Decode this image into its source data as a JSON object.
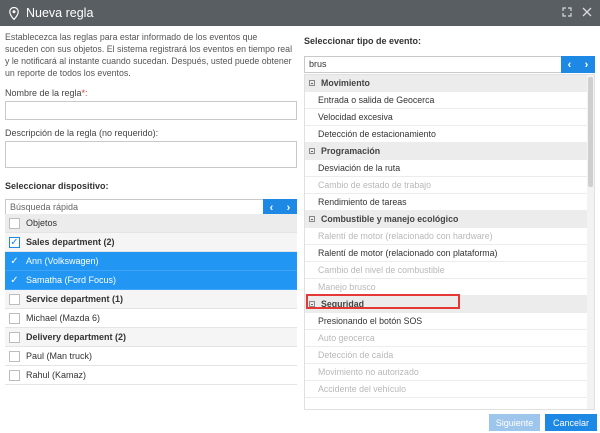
{
  "window": {
    "title": "Nueva regla",
    "icon": "map-pin-icon",
    "controls": [
      "expand-icon",
      "close-icon"
    ]
  },
  "intro": "Establecezca las reglas para estar informado de los eventos que suceden con sus objetos. El sistema registrará los eventos en tiempo real y le notificará al instante cuando sucedan. Después, usted puede obtener un reporte de todos los eventos.",
  "rule_name": {
    "label": "Nombre de la regla",
    "required_mark": "*:",
    "value": ""
  },
  "rule_desc": {
    "label": "Descripción de la regla (no requerido):",
    "value": ""
  },
  "device": {
    "label": "Seleccionar dispositivo:",
    "search_placeholder": "Búsqueda rápida",
    "header": "Objetos",
    "rows": [
      {
        "label": "Sales department (2)",
        "type": "group",
        "checked": true
      },
      {
        "label": "Ann (Volkswagen)",
        "type": "item",
        "checked": true
      },
      {
        "label": "Samatha (Ford Focus)",
        "type": "item",
        "checked": true
      },
      {
        "label": "Service department (1)",
        "type": "group",
        "checked": false
      },
      {
        "label": "Michael (Mazda 6)",
        "type": "item",
        "checked": false
      },
      {
        "label": "Delivery department (2)",
        "type": "group",
        "checked": false
      },
      {
        "label": "Paul (Man truck)",
        "type": "item",
        "checked": false
      },
      {
        "label": "Rahul (Kamaz)",
        "type": "item",
        "checked": false
      }
    ]
  },
  "event": {
    "label": "Seleccionar tipo de evento:",
    "search_value": "brus",
    "categories": [
      {
        "name": "Movimiento",
        "items": [
          {
            "label": "Entrada o salida de Geocerca",
            "enabled": true
          },
          {
            "label": "Velocidad excesiva",
            "enabled": true
          },
          {
            "label": "Detección de estacionamiento",
            "enabled": true
          }
        ]
      },
      {
        "name": "Programación",
        "items": [
          {
            "label": "Desviación de la ruta",
            "enabled": true
          },
          {
            "label": "Cambio de estado de trabajo",
            "enabled": false
          },
          {
            "label": "Rendimiento de tareas",
            "enabled": true
          }
        ]
      },
      {
        "name": "Combustible y manejo ecológico",
        "items": [
          {
            "label": "Ralentí de motor (relacionado con hardware)",
            "enabled": false
          },
          {
            "label": "Ralentí de motor (relacionado con plataforma)",
            "enabled": true
          },
          {
            "label": "Cambio del nivel de combustible",
            "enabled": false
          },
          {
            "label": "Manejo brusco",
            "enabled": false
          }
        ]
      },
      {
        "name": "Seguridad",
        "items": [
          {
            "label": "Presionando el botón SOS",
            "enabled": true
          },
          {
            "label": "Auto geocerca",
            "enabled": false
          },
          {
            "label": "Detección de caída",
            "enabled": false
          },
          {
            "label": "Movimiento no autorizado",
            "enabled": false
          },
          {
            "label": "Accidente del vehículo",
            "enabled": false
          }
        ]
      }
    ]
  },
  "buttons": {
    "next": "Siguiente",
    "cancel": "Cancelar"
  },
  "colors": {
    "accent": "#1e88e5",
    "titlebar": "#595e62",
    "highlight": "#e53935"
  }
}
